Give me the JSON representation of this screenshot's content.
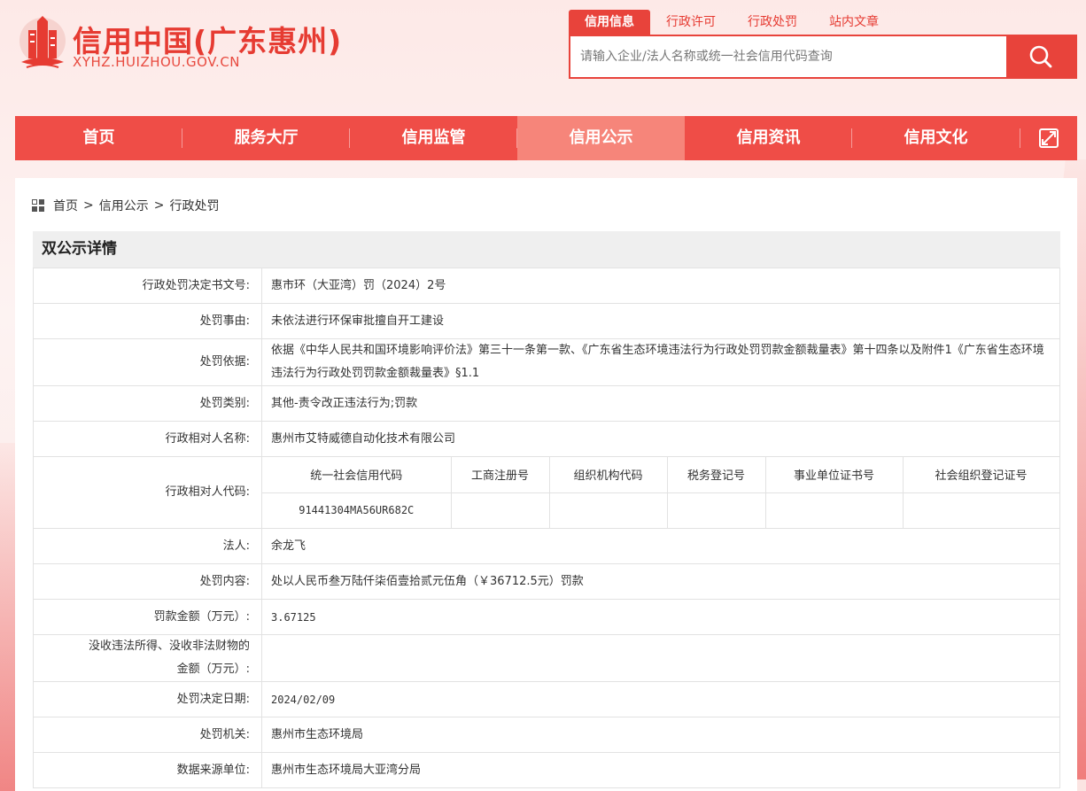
{
  "site": {
    "title": "信用中国(广东惠州)",
    "subtitle": "XYHZ.HUIZHOU.GOV.CN",
    "brand_color": "#e8433b"
  },
  "search": {
    "tabs": [
      {
        "label": "信用信息",
        "active": true
      },
      {
        "label": "行政许可",
        "active": false
      },
      {
        "label": "行政处罚",
        "active": false
      },
      {
        "label": "站内文章",
        "active": false
      }
    ],
    "placeholder": "请输入企业/法人名称或统一社会信用代码查询",
    "button_icon": "search-icon"
  },
  "nav": {
    "items": [
      {
        "label": "首页",
        "active": false
      },
      {
        "label": "服务大厅",
        "active": false
      },
      {
        "label": "信用监管",
        "active": false
      },
      {
        "label": "信用公示",
        "active": true
      },
      {
        "label": "信用资讯",
        "active": false
      },
      {
        "label": "信用文化",
        "active": false
      }
    ],
    "expand_icon": "expand-icon"
  },
  "breadcrumb": {
    "icon": "grid-icon",
    "items": [
      "首页",
      "信用公示",
      "行政处罚"
    ],
    "separator": ">"
  },
  "panel": {
    "title": "双公示详情"
  },
  "detail": {
    "decision_no": {
      "label": "行政处罚决定书文号:",
      "value": "惠市环（大亚湾）罚（2024）2号"
    },
    "reason": {
      "label": "处罚事由:",
      "value": "未依法进行环保审批擅自开工建设"
    },
    "basis": {
      "label": "处罚依据:",
      "value": "依据《中华人民共和国环境影响评价法》第三十一条第一款、《广东省生态环境违法行为行政处罚罚款金额裁量表》第十四条以及附件1《广东省生态环境违法行为行政处罚罚款金额裁量表》§1.1"
    },
    "category": {
      "label": "处罚类别:",
      "value": "其他-责令改正违法行为;罚款"
    },
    "party_name": {
      "label": "行政相对人名称:",
      "value": "惠州市艾特威德自动化技术有限公司"
    },
    "party_code": {
      "label": "行政相对人代码:",
      "headers": [
        "统一社会信用代码",
        "工商注册号",
        "组织机构代码",
        "税务登记号",
        "事业单位证书号",
        "社会组织登记证号"
      ],
      "values": [
        "91441304MA56UR682C",
        "",
        "",
        "",
        "",
        ""
      ]
    },
    "legal_person": {
      "label": "法人:",
      "value": "余龙飞"
    },
    "content": {
      "label": "处罚内容:",
      "value": "处以人民币叁万陆仟柒佰壹拾贰元伍角（￥36712.5元）罚款"
    },
    "fine_amount": {
      "label": "罚款金额（万元）:",
      "value": "3.67125"
    },
    "confiscation": {
      "label_line1": "没收违法所得、没收非法财物的",
      "label_line2": "金额（万元）:",
      "value": ""
    },
    "decision_date": {
      "label": "处罚决定日期:",
      "value": "2024/02/09"
    },
    "authority": {
      "label": "处罚机关:",
      "value": "惠州市生态环境局"
    },
    "source": {
      "label": "数据来源单位:",
      "value": "惠州市生态环境局大亚湾分局"
    }
  }
}
